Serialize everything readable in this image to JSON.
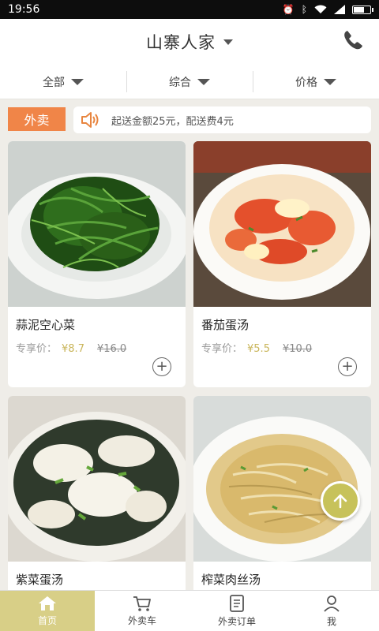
{
  "status_bar": {
    "time": "19:56"
  },
  "header": {
    "title": "山寨人家"
  },
  "filters": [
    {
      "label": "全部"
    },
    {
      "label": "综合"
    },
    {
      "label": "价格"
    }
  ],
  "notice": {
    "tag": "外卖",
    "text": "起送金额25元，配送费4元"
  },
  "dishes": [
    {
      "name": "蒜泥空心菜",
      "price_label": "专享价：",
      "price": "¥8.7",
      "old_price": "¥16.0"
    },
    {
      "name": "番茄蛋汤",
      "price_label": "专享价：",
      "price": "¥5.5",
      "old_price": "¥10.0"
    },
    {
      "name": "紫菜蛋汤"
    },
    {
      "name": "榨菜肉丝汤"
    }
  ],
  "tabbar": [
    {
      "label": "首页",
      "icon": "home-icon",
      "active": true
    },
    {
      "label": "外卖车",
      "icon": "cart-icon"
    },
    {
      "label": "外卖订单",
      "icon": "order-list-icon"
    },
    {
      "label": "我",
      "icon": "user-icon"
    }
  ],
  "colors": {
    "accent_orange": "#f08548",
    "price_gold": "#c9b55a",
    "tab_active": "#d8cf87",
    "fab": "#c7c25a"
  }
}
